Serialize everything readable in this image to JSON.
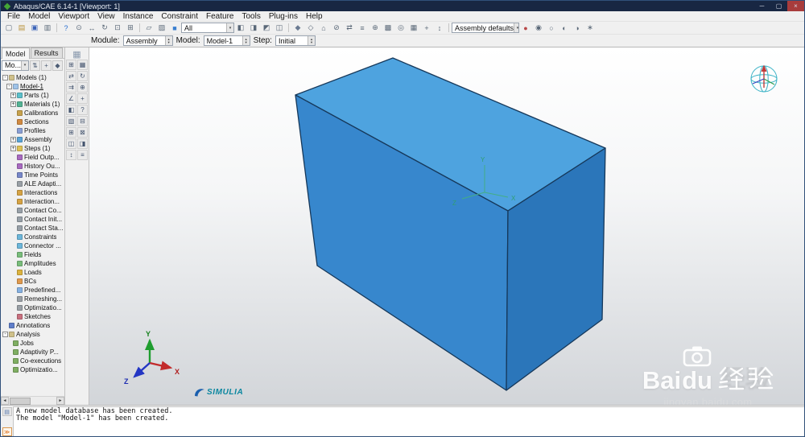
{
  "window": {
    "title": "Abaqus/CAE 6.14-1 [Viewport: 1]",
    "minimize_glyph": "─",
    "maximize_glyph": "▢",
    "close_glyph": "×"
  },
  "glyphs": {
    "spin_up": "▴",
    "spin_down": "▾",
    "scroll_left": "◄",
    "scroll_right": "►",
    "toolbox_handle": "▦",
    "message_tab": "▤",
    "cli_tab": "≫"
  },
  "menubar": {
    "items": [
      {
        "label": "File"
      },
      {
        "label": "Model"
      },
      {
        "label": "Viewport"
      },
      {
        "label": "View"
      },
      {
        "label": "Instance"
      },
      {
        "label": "Constraint"
      },
      {
        "label": "Feature"
      },
      {
        "label": "Tools"
      },
      {
        "label": "Plug-ins"
      },
      {
        "label": "Help"
      }
    ]
  },
  "toolbar": {
    "g1": [
      {
        "name": "new-file-icon",
        "glyph": "▢"
      },
      {
        "name": "open-file-icon",
        "glyph": "▤",
        "tint": "#b8923a"
      },
      {
        "name": "save-icon",
        "glyph": "▣",
        "tint": "#3a62b8"
      },
      {
        "name": "print-icon",
        "glyph": "▥"
      }
    ],
    "g2": [
      {
        "name": "query-info-icon",
        "glyph": "?",
        "tint": "#2a6fd0"
      },
      {
        "name": "magnify-icon",
        "glyph": "⊙"
      },
      {
        "name": "pan-view-icon",
        "glyph": "↔"
      },
      {
        "name": "rotate-view-icon",
        "glyph": "↻"
      },
      {
        "name": "zoom-box-icon",
        "glyph": "⊡"
      },
      {
        "name": "fit-view-icon",
        "glyph": "⊞"
      }
    ],
    "g3": [
      {
        "name": "wireframe-render-icon",
        "glyph": "▱"
      },
      {
        "name": "hiddenline-render-icon",
        "glyph": "▨"
      },
      {
        "name": "shaded-render-icon",
        "glyph": "■",
        "tint": "#3a7fd0"
      }
    ],
    "render_combo_value": "All",
    "g4": [
      {
        "name": "replace-displaygroup-icon",
        "glyph": "◧"
      },
      {
        "name": "add-displaygroup-icon",
        "glyph": "◨"
      },
      {
        "name": "remove-displaygroup-icon",
        "glyph": "◩"
      },
      {
        "name": "displaygroup-either-icon",
        "glyph": "◫"
      }
    ],
    "g5": [
      {
        "name": "perspective-on-icon",
        "glyph": "◆",
        "tint": "#6a7a92"
      },
      {
        "name": "perspective-off-icon",
        "glyph": "◇"
      },
      {
        "name": "views-home-icon",
        "glyph": "⌂"
      },
      {
        "name": "view-cut-icon",
        "glyph": "⊘"
      },
      {
        "name": "sync-viewports-icon",
        "glyph": "⇄"
      },
      {
        "name": "annotation-manager-icon",
        "glyph": "≡"
      },
      {
        "name": "datum-display-icon",
        "glyph": "⊕"
      },
      {
        "name": "superimpose-icon",
        "glyph": "▩"
      },
      {
        "name": "lighting-icon",
        "glyph": "◎"
      },
      {
        "name": "background-icon",
        "glyph": "▦"
      },
      {
        "name": "snap-icon",
        "glyph": "+"
      },
      {
        "name": "measure-icon",
        "glyph": "↕"
      }
    ],
    "color_combo_value": "Assembly defaults",
    "g6": [
      {
        "name": "color-code-dialog-icon",
        "glyph": "●",
        "tint": "#b84848"
      },
      {
        "name": "visibility-icon",
        "glyph": "◉"
      },
      {
        "name": "hide-objects-icon",
        "glyph": "○"
      },
      {
        "name": "contrast-icon",
        "glyph": "◐"
      },
      {
        "name": "shade-options-icon",
        "glyph": "◑"
      },
      {
        "name": "render-options-icon",
        "glyph": "∗"
      }
    ]
  },
  "context_bar": {
    "module_label": "Module:",
    "module_value": "Assembly",
    "model_label": "Model:",
    "model_value": "Model-1",
    "step_label": "Step:",
    "step_value": "Initial"
  },
  "tree_panel": {
    "tabs": [
      {
        "label": "Model",
        "state": "active"
      },
      {
        "label": "Results",
        "state": ""
      }
    ],
    "db_combo_value": "Mo...",
    "header_icons": [
      {
        "name": "tree-updown-icon",
        "glyph": "⇅"
      },
      {
        "name": "tree-expand-icon",
        "glyph": "+"
      },
      {
        "name": "tree-pin-icon",
        "glyph": "◆"
      }
    ],
    "items": [
      {
        "label": "Models (1)",
        "d": "d0",
        "t": "-",
        "ic": "#cfc08a"
      },
      {
        "label": "Model-1",
        "d": "d1",
        "t": "-",
        "ic": "#9fc3e8",
        "uc": "u"
      },
      {
        "label": "Parts (1)",
        "d": "d2",
        "t": "+",
        "ic": "#5bbfca"
      },
      {
        "label": "Materials (1)",
        "d": "d2",
        "t": "+",
        "ic": "#54b394"
      },
      {
        "label": "Calibrations",
        "d": "d2",
        "t": "",
        "ic": "#c7a24d"
      },
      {
        "label": "Sections",
        "d": "d2",
        "t": "",
        "ic": "#d18a42"
      },
      {
        "label": "Profiles",
        "d": "d2",
        "t": "",
        "ic": "#8a9fd4"
      },
      {
        "label": "Assembly",
        "d": "d2",
        "t": "+",
        "ic": "#5aa4d6"
      },
      {
        "label": "Steps (1)",
        "d": "d2",
        "t": "+",
        "ic": "#ddc155"
      },
      {
        "label": "Field Outp...",
        "d": "d2",
        "t": "",
        "ic": "#a86ac0"
      },
      {
        "label": "History Ou...",
        "d": "d2",
        "t": "",
        "ic": "#a86ac0"
      },
      {
        "label": "Time Points",
        "d": "d2",
        "t": "",
        "ic": "#7787c9"
      },
      {
        "label": "ALE Adapti...",
        "d": "d2",
        "t": "",
        "ic": "#9aa0a6"
      },
      {
        "label": "Interactions",
        "d": "d2",
        "t": "",
        "ic": "#d6a344"
      },
      {
        "label": "Interaction...",
        "d": "d2",
        "t": "",
        "ic": "#d6a344"
      },
      {
        "label": "Contact Co...",
        "d": "d2",
        "t": "",
        "ic": "#98a0a8"
      },
      {
        "label": "Contact Init...",
        "d": "d2",
        "t": "",
        "ic": "#98a0a8"
      },
      {
        "label": "Contact Sta...",
        "d": "d2",
        "t": "",
        "ic": "#98a0a8"
      },
      {
        "label": "Constraints",
        "d": "d2",
        "t": "",
        "ic": "#6cb6da"
      },
      {
        "label": "Connector ...",
        "d": "d2",
        "t": "",
        "ic": "#6cb6da"
      },
      {
        "label": "Fields",
        "d": "d2",
        "t": "",
        "ic": "#79bd7b"
      },
      {
        "label": "Amplitudes",
        "d": "d2",
        "t": "",
        "ic": "#79bd7b"
      },
      {
        "label": "Loads",
        "d": "d2",
        "t": "",
        "ic": "#dcb23e"
      },
      {
        "label": "BCs",
        "d": "d2",
        "t": "",
        "ic": "#e09a4e"
      },
      {
        "label": "Predefined...",
        "d": "d2",
        "t": "",
        "ic": "#86b1e2"
      },
      {
        "label": "Remeshing...",
        "d": "d2",
        "t": "",
        "ic": "#9aa0a6"
      },
      {
        "label": "Optimizatio...",
        "d": "d2",
        "t": "",
        "ic": "#9aa0a6"
      },
      {
        "label": "Sketches",
        "d": "d2",
        "t": "",
        "ic": "#c9707f"
      },
      {
        "label": "Annotations",
        "d": "d0",
        "t": "",
        "ic": "#5f7ec9"
      },
      {
        "label": "Analysis",
        "d": "d0",
        "t": "-",
        "ic": "#cfc08a"
      },
      {
        "label": "Jobs",
        "d": "d1",
        "t": "",
        "ic": "#7fae62"
      },
      {
        "label": "Adaptivity P...",
        "d": "d1",
        "t": "",
        "ic": "#7fae62"
      },
      {
        "label": "Co-executions",
        "d": "d1",
        "t": "",
        "ic": "#7fae62"
      },
      {
        "label": "Optimizatio...",
        "d": "d1",
        "t": "",
        "ic": "#7fae62"
      }
    ]
  },
  "toolbox": {
    "icons": [
      {
        "name": "create-instance-icon",
        "glyph": "⊞"
      },
      {
        "name": "instance-pattern-icon",
        "glyph": "▦"
      },
      {
        "name": "translate-instance-icon",
        "glyph": "⇄"
      },
      {
        "name": "rotate-instance-icon",
        "glyph": "↻"
      },
      {
        "name": "translate-to-icon",
        "glyph": "⇉"
      },
      {
        "name": "merge-cut-icon",
        "glyph": "⊕"
      },
      {
        "name": "create-constraint-icon",
        "glyph": "∠"
      },
      {
        "name": "create-datum-icon",
        "glyph": "+"
      },
      {
        "name": "partition-icon",
        "glyph": "◧"
      },
      {
        "name": "query-icon",
        "glyph": "?"
      },
      {
        "name": "feature-edit-icon",
        "glyph": "▧"
      },
      {
        "name": "feature-suppress-icon",
        "glyph": "⊟"
      },
      {
        "name": "feature-resume-icon",
        "glyph": "⊞"
      },
      {
        "name": "feature-delete-icon",
        "glyph": "⊠"
      },
      {
        "name": "model-display-icon",
        "glyph": "◫"
      },
      {
        "name": "section-view-icon",
        "glyph": "◨"
      },
      {
        "name": "measure-distance-icon",
        "glyph": "↕"
      },
      {
        "name": "toolset-options-icon",
        "glyph": "≡"
      }
    ]
  },
  "viewport": {
    "box_colors": {
      "top": "#4ea3df",
      "front": "#3787cd",
      "right": "#2b76ba"
    },
    "csys_triad": {
      "x": "X",
      "y": "Y",
      "z": "Z"
    },
    "origin_triad": {
      "x": "X",
      "y": "Y",
      "z": "Z"
    },
    "simulia_text": "SIMULIA"
  },
  "watermark": {
    "text_bai": "Bai",
    "text_du": "du",
    "text_cn": "经验",
    "url": "jingyan.baidu.com"
  },
  "message_area": {
    "lines": [
      {
        "text": "A new model database has been created."
      },
      {
        "text": "The model \"Model-1\" has been created."
      }
    ]
  }
}
